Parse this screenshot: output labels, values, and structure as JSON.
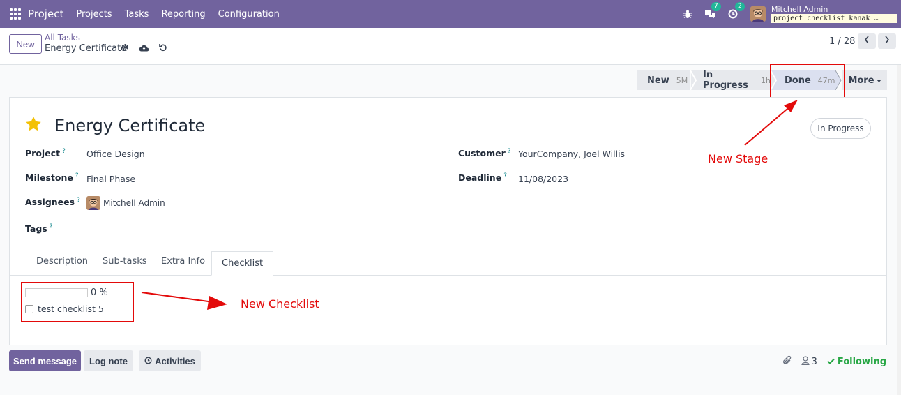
{
  "navbar": {
    "app_name": "Project",
    "menu": [
      "Projects",
      "Tasks",
      "Reporting",
      "Configuration"
    ],
    "messages_count": "7",
    "activities_count": "2",
    "user_name": "Mitchell Admin",
    "database": "project_checklist_kanak_…"
  },
  "control_panel": {
    "new_label": "New",
    "breadcrumb_parent": "All Tasks",
    "breadcrumb_current": "Energy Certificate",
    "pager": "1 / 28"
  },
  "statusbar": {
    "stages": [
      {
        "label": "New",
        "duration": "5M"
      },
      {
        "label": "In Progress",
        "duration": "1h"
      },
      {
        "label": "Done",
        "duration": "47m"
      }
    ],
    "more_label": "More"
  },
  "task": {
    "title": "Energy Certificate",
    "state": "In Progress",
    "fields": {
      "project_label": "Project",
      "project": "Office Design",
      "milestone_label": "Milestone",
      "milestone": "Final Phase",
      "assignees_label": "Assignees",
      "assignee": "Mitchell Admin",
      "tags_label": "Tags",
      "customer_label": "Customer",
      "customer": "YourCompany, Joel Willis",
      "deadline_label": "Deadline",
      "deadline": "11/08/2023"
    },
    "help_mark": "?"
  },
  "tabs": [
    "Description",
    "Sub-tasks",
    "Extra Info",
    "Checklist"
  ],
  "checklist": {
    "progress_text": "0 %",
    "progress": 0,
    "items": [
      {
        "label": "test checklist 5",
        "checked": false
      }
    ]
  },
  "annotations": {
    "new_stage": "New Stage",
    "new_checklist": "New Checklist"
  },
  "chatter": {
    "send_message": "Send message",
    "log_note": "Log note",
    "activities": "Activities",
    "followers_count": "3",
    "following": "Following"
  },
  "colors": {
    "brand": "#71639e",
    "annotation_red": "#e30a0a",
    "following_green": "#28a745"
  }
}
